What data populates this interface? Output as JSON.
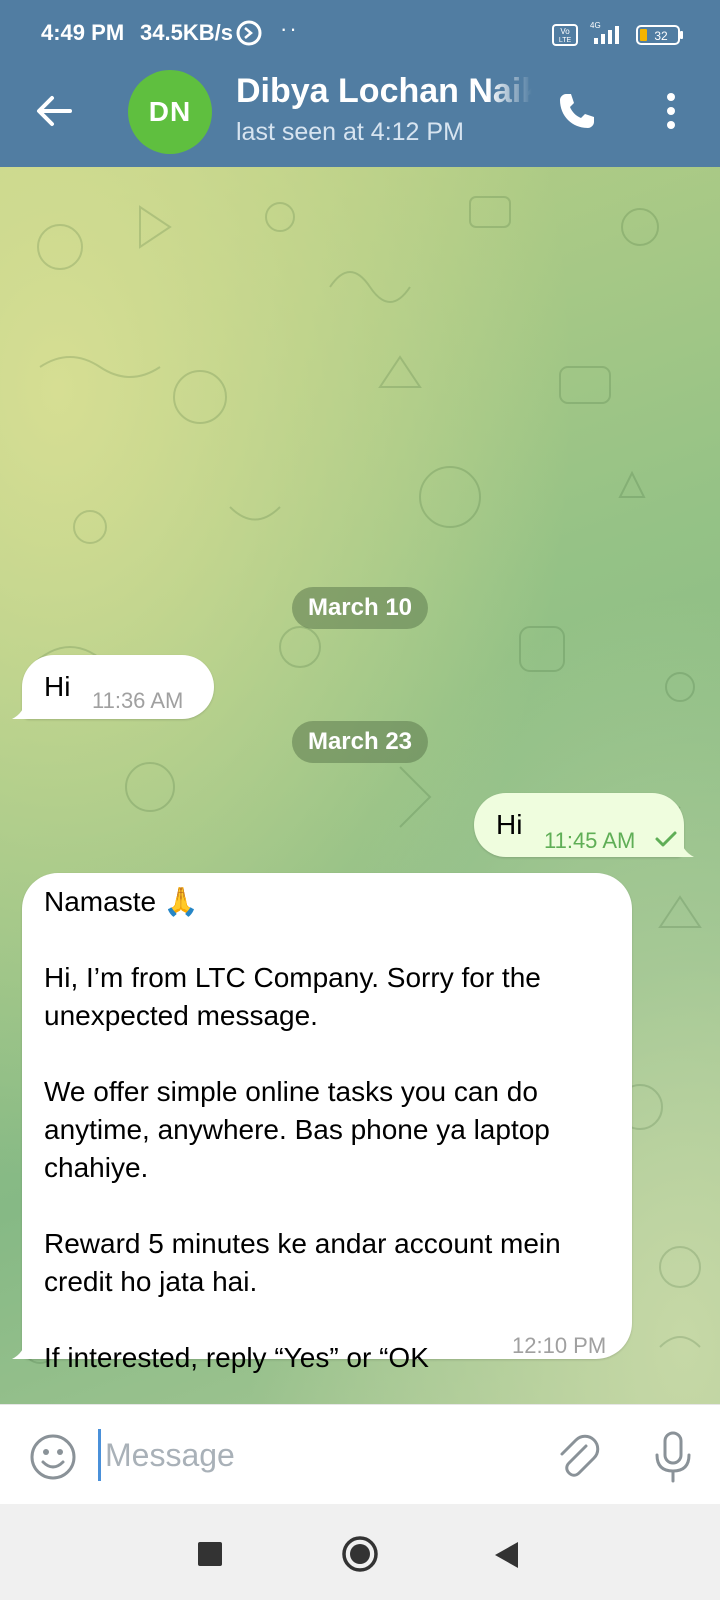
{
  "status_bar": {
    "time": "4:49 PM",
    "net_speed": "34.5KB/s",
    "network": "4G",
    "volte": "Vo LTE",
    "battery": "32"
  },
  "header": {
    "avatar_initials": "DN",
    "avatar_color": "#5fbf3f",
    "contact_name": "Dibya Lochan Naik",
    "last_seen": "last seen at 4:12 PM",
    "bar_color": "#517da2"
  },
  "chat": {
    "dates": [
      "March 10",
      "March 23"
    ],
    "messages": [
      {
        "direction": "incoming",
        "text": "Hi",
        "time": "11:36 AM"
      },
      {
        "direction": "outgoing",
        "text": "Hi",
        "time": "11:45 AM",
        "status": "sent-check-icon"
      },
      {
        "direction": "incoming",
        "paragraphs": [
          "Namaste 🙏",
          "Hi, I’m from LTC Company. Sorry for the unexpected message.",
          "We offer simple online tasks you can do anytime, anywhere. Bas phone ya laptop chahiye.",
          "Reward 5 minutes ke andar account mein credit ho jata hai.",
          "If interested, reply “Yes” or “OK"
        ],
        "time": "12:10 PM"
      }
    ]
  },
  "input_bar": {
    "placeholder": "Message",
    "value": ""
  },
  "icons": {
    "back": "arrow-left-icon",
    "call": "phone-icon",
    "menu": "kebab-menu-icon",
    "emoji": "emoji-icon",
    "attach": "paperclip-icon",
    "mic": "microphone-icon",
    "nav_recents": "square-icon",
    "nav_home": "circle-icon",
    "nav_back": "triangle-icon"
  }
}
